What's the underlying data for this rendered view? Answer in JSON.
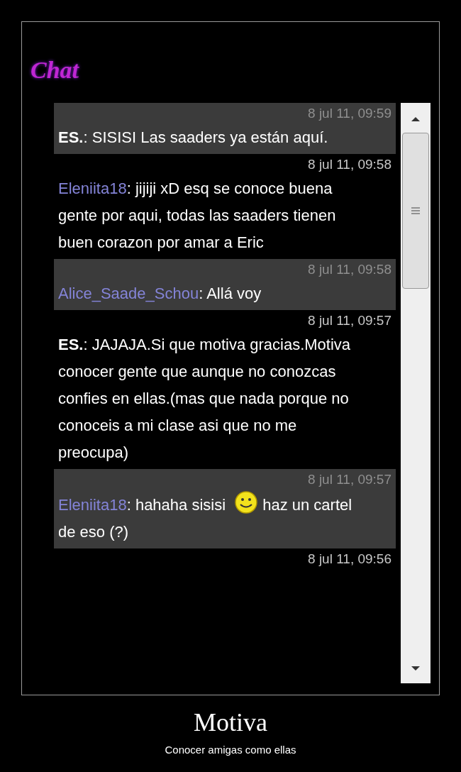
{
  "chat": {
    "title": "Chat",
    "messages": [
      {
        "time": "8 jul 11, 09:59",
        "author": "ES.",
        "separator": ":",
        "color": "#ffffff",
        "shaded": true,
        "segments": [
          {
            "kind": "text",
            "text": "SISISI Las saaders ya están aquí."
          }
        ]
      },
      {
        "time": "8 jul 11, 09:58",
        "author": "Eleniita18",
        "separator": ":",
        "color": "#8484d8",
        "shaded": false,
        "segments": [
          {
            "kind": "text",
            "text": "jijiji xD esq se conoce buena gente por aqui, todas las saaders tienen buen corazon por amar a Eric"
          }
        ]
      },
      {
        "time": "8 jul 11, 09:58",
        "author": "Alice_Saade_Schou",
        "separator": ":",
        "color": "#8484d8",
        "shaded": true,
        "segments": [
          {
            "kind": "text",
            "text": "Allá voy"
          }
        ]
      },
      {
        "time": "8 jul 11, 09:57",
        "author": "ES.",
        "separator": ":",
        "color": "#ffffff",
        "shaded": false,
        "segments": [
          {
            "kind": "text",
            "text": "JAJAJA.Si que motiva gracias.Motiva conocer gente que aunque no conozcas confies en ellas.(mas que nada porque no conoceis a mi clase asi que no me preocupa)"
          }
        ]
      },
      {
        "time": "8 jul 11, 09:57",
        "author": "Eleniita18",
        "separator": ":",
        "color": "#8484d8",
        "shaded": true,
        "segments": [
          {
            "kind": "text",
            "text": "hahaha sisisi"
          },
          {
            "kind": "smiley"
          },
          {
            "kind": "text",
            "text": "haz un cartel de eso (?)"
          }
        ]
      },
      {
        "time": "8 jul 11, 09:56",
        "shaded": false
      }
    ]
  },
  "caption": {
    "title": "Motiva",
    "subtitle": "Conocer amigas como ellas"
  }
}
